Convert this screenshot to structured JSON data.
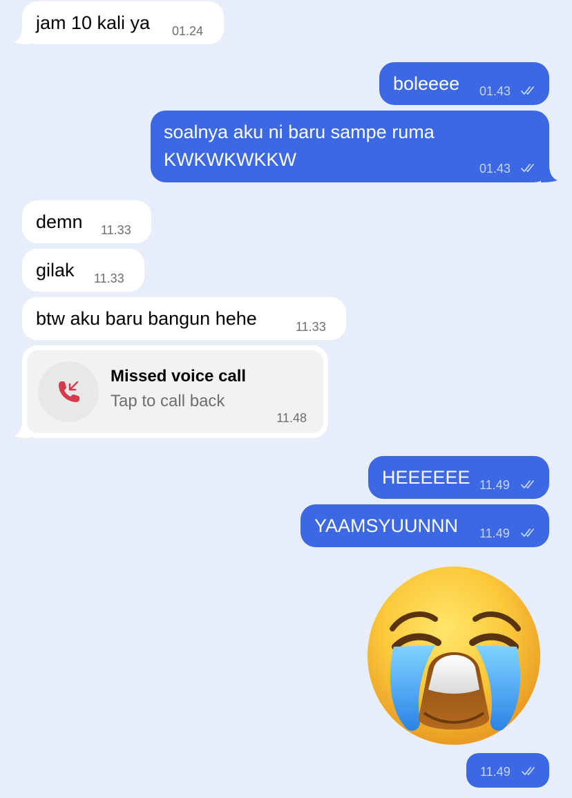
{
  "colors": {
    "background": "#e7eef9",
    "incoming_bubble": "#ffffff",
    "outgoing_bubble": "#3c69e3",
    "missed_call_icon": "#d63a4d"
  },
  "messages": [
    {
      "direction": "incoming",
      "text": "jam 10 kali ya",
      "time": "01.24"
    },
    {
      "direction": "outgoing",
      "text": "boleeee",
      "time": "01.43",
      "read_icon": "double-check-icon"
    },
    {
      "direction": "outgoing",
      "text_line1": "soalnya aku ni baru sampe ruma",
      "text_line2": "KWKWKWKKW",
      "time": "01.43",
      "read_icon": "double-check-icon"
    },
    {
      "direction": "incoming",
      "text": "demn",
      "time": "11.33"
    },
    {
      "direction": "incoming",
      "text": "gilak",
      "time": "11.33"
    },
    {
      "direction": "incoming",
      "text": "btw aku baru bangun hehe",
      "time": "11.33"
    },
    {
      "direction": "incoming",
      "type": "missed-call",
      "title": "Missed voice call",
      "subtitle": "Tap to call back",
      "time": "11.48",
      "icon": "missed-call-icon"
    },
    {
      "direction": "outgoing",
      "text": "HEEEEEE",
      "time": "11.49",
      "read_icon": "double-check-icon"
    },
    {
      "direction": "outgoing",
      "text": "YAAMSYUUNNN",
      "time": "11.49",
      "read_icon": "double-check-icon"
    },
    {
      "direction": "outgoing",
      "type": "sticker",
      "sticker": "loudly-crying-face-emoji"
    },
    {
      "direction": "outgoing",
      "time": "11.49",
      "read_icon": "double-check-icon"
    }
  ]
}
